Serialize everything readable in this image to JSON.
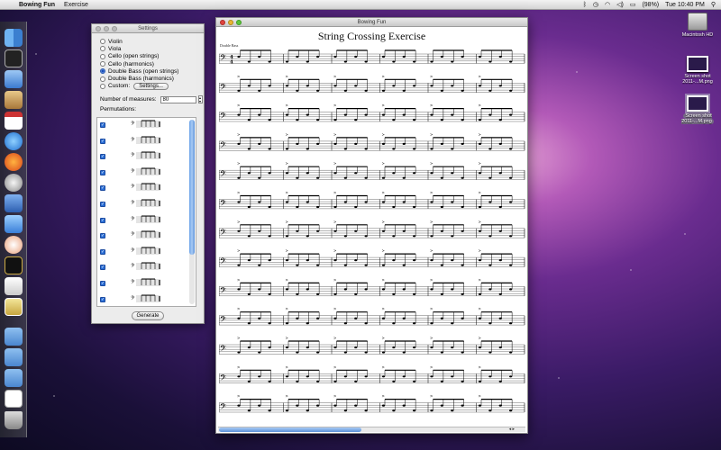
{
  "menubar": {
    "apple": "",
    "app_name": "Bowing Fun",
    "menus": [
      "Exercise"
    ],
    "battery": "(98%)",
    "clock": "Tue 10:40 PM"
  },
  "settings_window": {
    "title": "Settings",
    "instruments": [
      {
        "label": "Violin",
        "selected": false
      },
      {
        "label": "Viola",
        "selected": false
      },
      {
        "label": "Cello (open strings)",
        "selected": false
      },
      {
        "label": "Cello (harmonics)",
        "selected": false
      },
      {
        "label": "Double Bass (open strings)",
        "selected": true
      },
      {
        "label": "Double Bass (harmonics)",
        "selected": false
      },
      {
        "label": "Custom:",
        "selected": false
      }
    ],
    "custom_settings_label": "Settings...",
    "measures_label": "Number of measures:",
    "measures_value": "80",
    "permutations_label": "Permutations:",
    "permutations_checked": [
      true,
      true,
      true,
      true,
      true,
      true,
      true,
      true,
      true,
      true,
      true,
      true
    ],
    "generate_label": "Generate"
  },
  "main_window": {
    "title": "Bowing Fun",
    "document_title": "String Crossing Exercise",
    "instrument_label": "Double Bass",
    "time_signature": "4/4",
    "systems": 13
  },
  "desktop": {
    "icons": [
      {
        "label": "Macintosh HD"
      },
      {
        "label": "Screen shot 2011-...M.png"
      },
      {
        "label": "Screen shot 2011-...M.png"
      }
    ]
  },
  "colors": {
    "accent": "#2b6fd6",
    "close": "#e0443e",
    "minimize": "#e9b532",
    "zoom": "#5fc63a"
  }
}
